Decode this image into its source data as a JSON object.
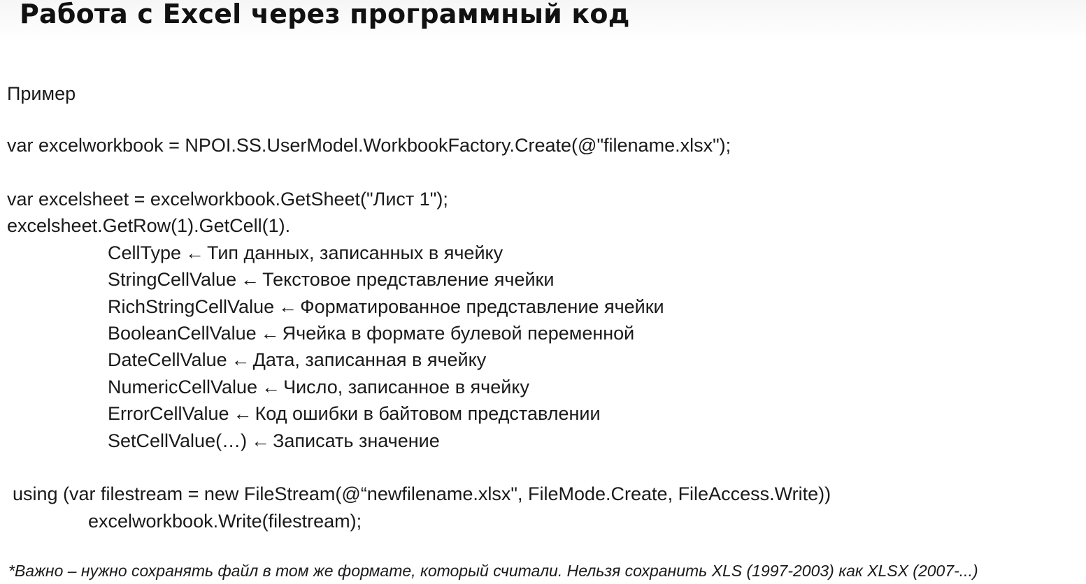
{
  "title": "Работа с Excel через программный код",
  "subtitle": "Пример",
  "code": {
    "workbook_line": "var excelworkbook = NPOI.SS.UserModel.WorkbookFactory.Create(@\"filename.xlsx\");",
    "sheet_line": "var excelsheet = excelworkbook.GetSheet(\"Лист 1\");",
    "row_line": "excelsheet.GetRow(1).GetCell(1).",
    "properties": [
      {
        "name": "CellType",
        "desc": "Тип данных, записанных в ячейку"
      },
      {
        "name": "StringCellValue",
        "desc": "Текстовое представление ячейки"
      },
      {
        "name": "RichStringCellValue",
        "desc": "Форматированное представление ячейки"
      },
      {
        "name": "BooleanCellValue",
        "desc": "Ячейка в формате булевой переменной"
      },
      {
        "name": "DateCellValue",
        "desc": "Дата, записанная в ячейку"
      },
      {
        "name": "NumericCellValue",
        "desc": "Число, записанное в ячейку"
      },
      {
        "name": "ErrorCellValue",
        "desc": "Код ошибки в байтовом представлении"
      },
      {
        "name": "SetCellValue(…)",
        "desc": "Записать значение"
      }
    ],
    "arrow": "←",
    "using_line": "using (var filestream = new FileStream(@“newfilename.xlsx\", FileMode.Create, FileAccess.Write))",
    "write_line": "excelworkbook.Write(filestream);"
  },
  "footnote": "*Важно – нужно сохранять файл в том же формате, который считали. Нельзя сохранить  XLS (1997-2003) как XLSX (2007-...)"
}
